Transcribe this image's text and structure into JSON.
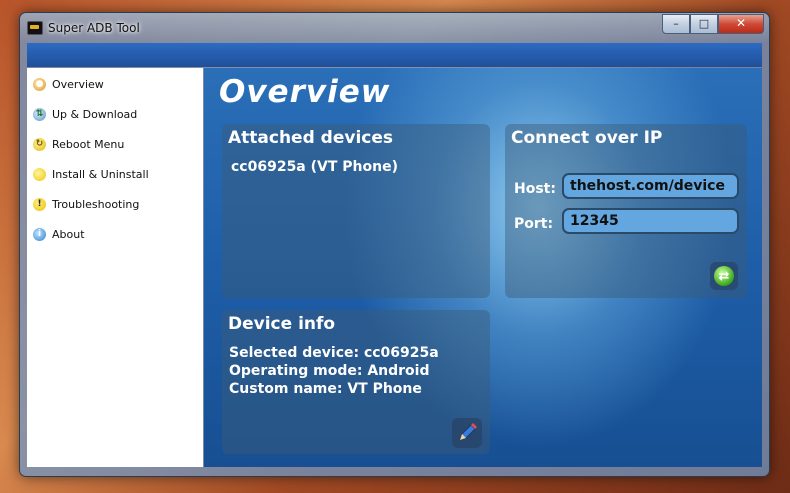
{
  "window": {
    "title": "Super ADB Tool"
  },
  "caption": {
    "minimize": "–",
    "maximize": "□",
    "close": "✕"
  },
  "sidebar": {
    "items": [
      {
        "label": "Overview",
        "icon": "overview-icon"
      },
      {
        "label": "Up & Download",
        "icon": "up-download-icon"
      },
      {
        "label": "Reboot Menu",
        "icon": "reboot-icon"
      },
      {
        "label": "Install & Uninstall",
        "icon": "install-icon"
      },
      {
        "label": "Troubleshooting",
        "icon": "warning-icon"
      },
      {
        "label": "About",
        "icon": "info-icon"
      }
    ]
  },
  "main": {
    "title": "Overview",
    "attached": {
      "title": "Attached devices",
      "devices": [
        "cc06925a (VT Phone)"
      ]
    },
    "connect": {
      "title": "Connect over IP",
      "host_label": "Host:",
      "host_value": "thehost.com/device",
      "port_label": "Port:",
      "port_value": "12345"
    },
    "device_info": {
      "title": "Device info",
      "selected": "Selected device: cc06925a",
      "mode": "Operating mode: Android",
      "custom_name": "Custom name: VT Phone"
    }
  },
  "colors": {
    "accent": "#1f5ea8",
    "input_bg": "#63a6e0",
    "panel_bg": "#3c5a78"
  }
}
